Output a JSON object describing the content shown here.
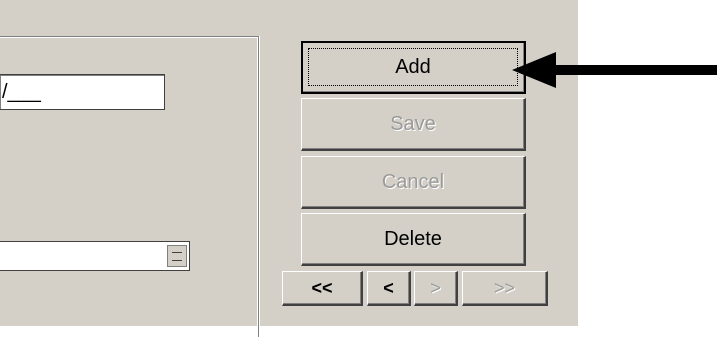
{
  "form": {
    "date_value": "/___"
  },
  "buttons": {
    "add": "Add",
    "save": "Save",
    "cancel": "Cancel",
    "delete": "Delete"
  },
  "navigation": {
    "first": "<<",
    "prev": "<",
    "next": ">",
    "last": ">>"
  },
  "colors": {
    "dialog_background": "#d4d0c8",
    "disabled_text": "#9a9a9a",
    "arrow": "#000000"
  }
}
